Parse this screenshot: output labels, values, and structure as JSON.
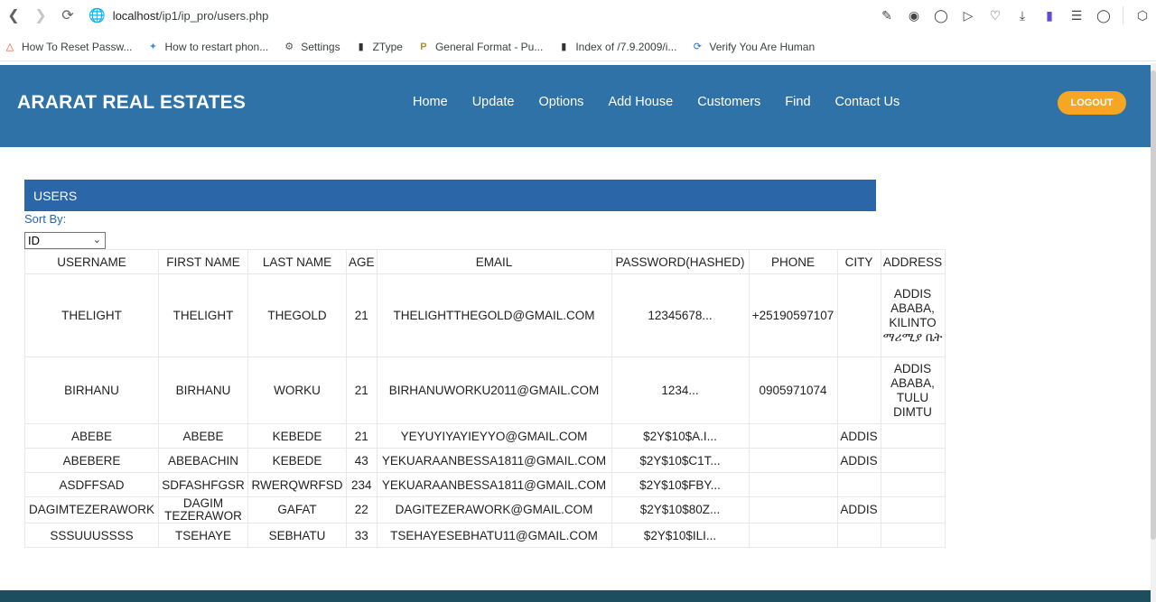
{
  "browser": {
    "url_host": "localhost",
    "url_path": "/ip1/ip_pro/users.php"
  },
  "bookmarks": [
    {
      "label": "How To Reset Passw...",
      "icon": "html5-icon"
    },
    {
      "label": "How to restart phon...",
      "icon": "bird-icon"
    },
    {
      "label": "Settings",
      "icon": "gear-icon"
    },
    {
      "label": "ZType",
      "icon": "file-icon"
    },
    {
      "label": "General Format - Pu...",
      "icon": "purdue-icon"
    },
    {
      "label": "Index of /7.9.2009/i...",
      "icon": "file-icon"
    },
    {
      "label": "Verify You Are Human",
      "icon": "cloudflare-icon"
    }
  ],
  "header": {
    "brand": "ARARAT REAL ESTATES",
    "nav": [
      "Home",
      "Update",
      "Options",
      "Add House",
      "Customers",
      "Find",
      "Contact Us"
    ],
    "logout": "LOGOUT",
    "colors": {
      "header": "#2f72a8",
      "logout": "#f5a623"
    }
  },
  "users": {
    "panel_title": "USERS",
    "sort_label": "Sort By:",
    "sort_value": "ID",
    "columns": [
      "USERNAME",
      "FIRST NAME",
      "LAST NAME",
      "AGE",
      "EMAIL",
      "PASSWORD(HASHED)",
      "PHONE",
      "CITY",
      "ADDRESS"
    ],
    "rows": [
      {
        "username": "THELIGHT",
        "first": "THELIGHT",
        "last": "THEGOLD",
        "age": "21",
        "email": "THELIGHTTHEGOLD@GMAIL.COM",
        "password": "12345678...",
        "phone": "+25190597107",
        "city": "",
        "address": "ADDIS ABABA, KILINTO ማሪሚያ ቤት"
      },
      {
        "username": "BIRHANU",
        "first": "BIRHANU",
        "last": "WORKU",
        "age": "21",
        "email": "BIRHANUWORKU2011@GMAIL.COM",
        "password": "1234...",
        "phone": "0905971074",
        "city": "",
        "address": "ADDIS ABABA, TULU DIMTU"
      },
      {
        "username": "ABEBE",
        "first": "ABEBE",
        "last": "KEBEDE",
        "age": "21",
        "email": "YEYUYIYAYIEYYO@GMAIL.COM",
        "password": "$2Y$10$A.I...",
        "phone": "",
        "city": "ADDIS",
        "address": ""
      },
      {
        "username": "ABEBERE",
        "first": "ABEBACHIN",
        "last": "KEBEDE",
        "age": "43",
        "email": "YEKUARAANBESSA1811@GMAIL.COM",
        "password": "$2Y$10$C1T...",
        "phone": "",
        "city": "ADDIS",
        "address": ""
      },
      {
        "username": "ASDFFSAD",
        "first": "SDFASHFGSR",
        "last": "RWERQWRFSD",
        "age": "234",
        "email": "YEKUARAANBESSA1811@GMAIL.COM",
        "password": "$2Y$10$FBY...",
        "phone": "",
        "city": "",
        "address": ""
      },
      {
        "username": "DAGIMTEZERAWORK",
        "first": "DAGIM TEZERAWOR",
        "last": "GAFAT",
        "age": "22",
        "email": "DAGITEZERAWORK@GMAIL.COM",
        "password": "$2Y$10$80Z...",
        "phone": "",
        "city": "ADDIS",
        "address": ""
      },
      {
        "username": "SSSUUUSSSS",
        "first": "TSEHAYE",
        "last": "SEBHATU",
        "age": "33",
        "email": "TSEHAYESEBHATU11@GMAIL.COM",
        "password": "$2Y$10$ILI...",
        "phone": "",
        "city": "",
        "address": ""
      }
    ]
  }
}
